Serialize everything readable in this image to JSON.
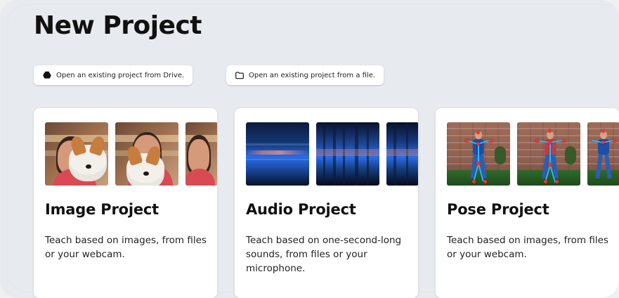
{
  "page": {
    "title": "New Project"
  },
  "actions": {
    "drive_button_label": "Open an existing project from Drive.",
    "file_button_label": "Open an existing project from a file."
  },
  "cards": [
    {
      "title": "Image Project",
      "description": "Teach based on images, from files or your webcam.",
      "thumbnail_icon": "image-samples"
    },
    {
      "title": "Audio Project",
      "description": "Teach based on one-second-long sounds, from files or your microphone.",
      "thumbnail_icon": "audio-spectrograms"
    },
    {
      "title": "Pose Project",
      "description": "Teach based on images, from files or your webcam.",
      "thumbnail_icon": "pose-skeleton-samples"
    }
  ],
  "colors": {
    "background": "#e7eaee",
    "card": "#ffffff",
    "title_text": "#111111",
    "body_text": "#222222",
    "accent_pose": "#2db7ff",
    "accent_joint": "#ff2d2d"
  },
  "icons": {
    "drive": "drive-icon",
    "folder": "folder-icon"
  }
}
